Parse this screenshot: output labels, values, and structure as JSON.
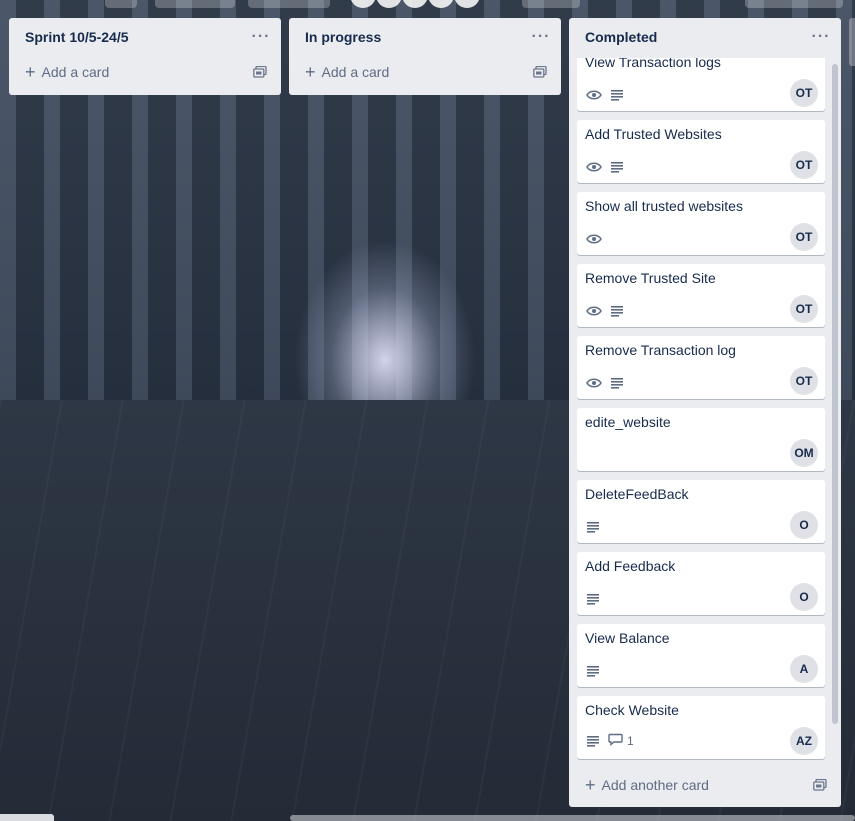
{
  "lists": [
    {
      "title": "Sprint 10/5-24/5",
      "add_card_label": "Add a card",
      "menu_glyph": "···"
    },
    {
      "title": "In progress",
      "add_card_label": "Add a card",
      "menu_glyph": "···"
    },
    {
      "title": "Completed",
      "add_card_label": "Add another card",
      "menu_glyph": "···",
      "cards": [
        {
          "title": "View Transaction logs",
          "watch": true,
          "description": true,
          "avatar": "OT"
        },
        {
          "title": "Add Trusted Websites",
          "watch": true,
          "description": true,
          "avatar": "OT"
        },
        {
          "title": "Show all trusted websites",
          "watch": true,
          "description": false,
          "avatar": "OT"
        },
        {
          "title": "Remove Trusted Site",
          "watch": true,
          "description": true,
          "avatar": "OT"
        },
        {
          "title": "Remove Transaction log",
          "watch": true,
          "description": true,
          "avatar": "OT"
        },
        {
          "title": "edite_website",
          "watch": false,
          "description": false,
          "avatar": "OM"
        },
        {
          "title": "DeleteFeedBack",
          "watch": false,
          "description": true,
          "avatar": "O"
        },
        {
          "title": "Add Feedback",
          "watch": false,
          "description": true,
          "avatar": "O"
        },
        {
          "title": "View Balance",
          "watch": false,
          "description": true,
          "avatar": "A"
        },
        {
          "title": "Check Website",
          "watch": false,
          "description": true,
          "comments": "1",
          "avatar": "AZ"
        }
      ]
    }
  ],
  "colors": {
    "list_bg": "#ebecf0",
    "card_bg": "#ffffff",
    "text_primary": "#172b4d",
    "text_muted": "#5e6c84",
    "avatar_bg": "#dfe1e6"
  }
}
